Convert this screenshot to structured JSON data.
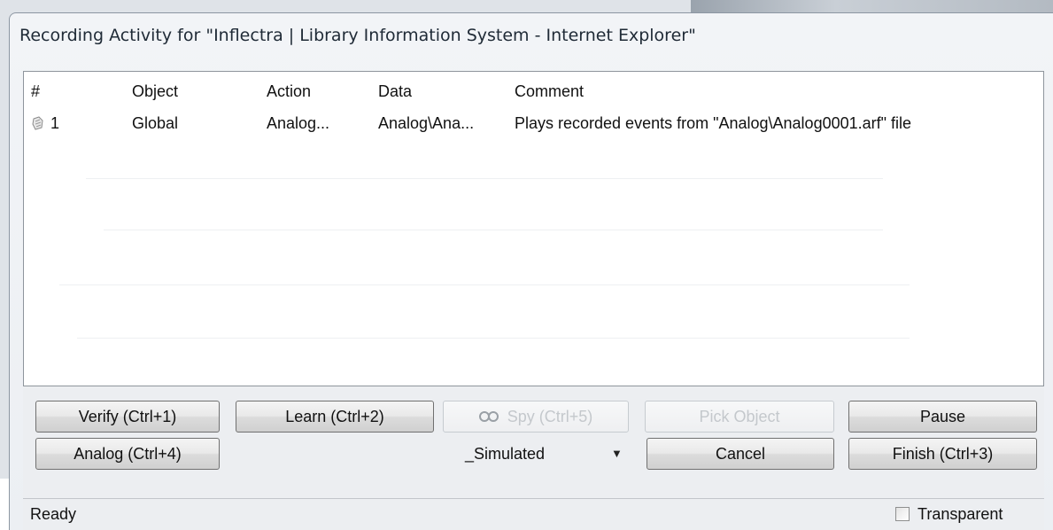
{
  "window": {
    "title": "Recording Activity for \"Inflectra | Library Information System - Internet Explorer\""
  },
  "grid": {
    "columns": [
      "#",
      "Object",
      "Action",
      "Data",
      "Comment"
    ],
    "rows": [
      {
        "icon": "playback-icon",
        "number": "1",
        "object": "Global",
        "action": "Analog...",
        "data": "Analog\\Ana...",
        "comment": "Plays recorded events from \"Analog\\Analog0001.arf\" file"
      }
    ]
  },
  "buttons": {
    "verify": "Verify (Ctrl+1)",
    "learn": "Learn (Ctrl+2)",
    "spy": "Spy (Ctrl+5)",
    "pick_object": "Pick Object",
    "pause": "Pause",
    "analog": "Analog (Ctrl+4)",
    "cancel": "Cancel",
    "finish": "Finish (Ctrl+3)"
  },
  "mode_select": {
    "value": "_Simulated"
  },
  "status": {
    "text": "Ready",
    "transparent_label": "Transparent",
    "transparent_checked": false
  }
}
